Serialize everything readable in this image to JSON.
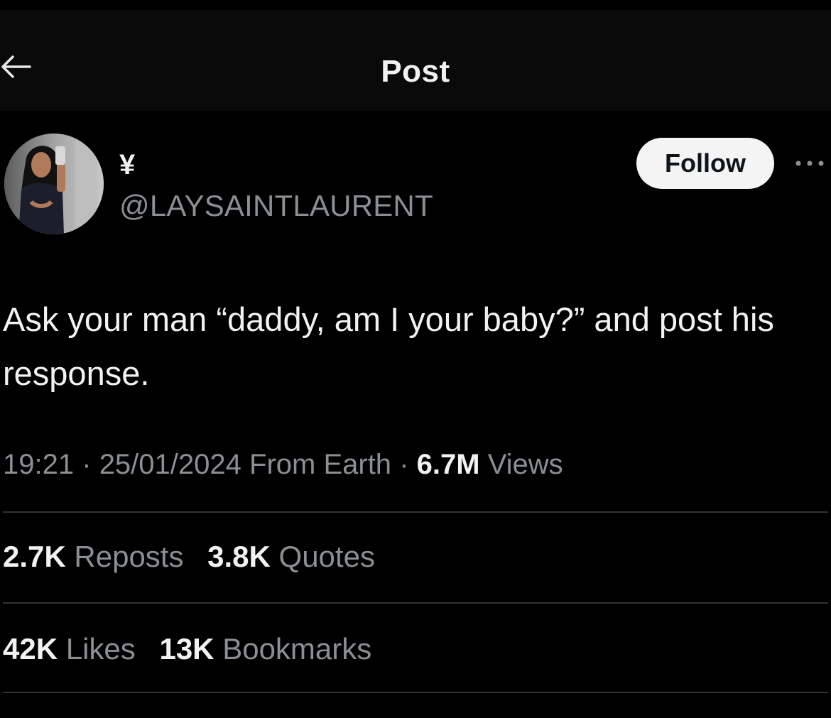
{
  "header": {
    "title": "Post",
    "back_icon": "arrow-left-icon"
  },
  "author": {
    "display_name": "¥",
    "handle": "@LAYSAINTLAURENT",
    "follow_label": "Follow",
    "more_icon": "more-horizontal-icon"
  },
  "post": {
    "text": "Ask your man “daddy, am I your baby?” and post his response.",
    "time": "19:21",
    "separator": "·",
    "date": "25/01/2024",
    "source": "From Earth",
    "views_count": "6.7M",
    "views_label": "Views"
  },
  "stats": {
    "reposts_count": "2.7K",
    "reposts_label": "Reposts",
    "quotes_count": "3.8K",
    "quotes_label": "Quotes",
    "likes_count": "42K",
    "likes_label": "Likes",
    "bookmarks_count": "13K",
    "bookmarks_label": "Bookmarks"
  },
  "colors": {
    "background": "#000000",
    "text_primary": "#f2f2f2",
    "text_secondary": "#8b8f94",
    "divider": "#2f3336",
    "follow_bg": "#f4f4f4"
  }
}
